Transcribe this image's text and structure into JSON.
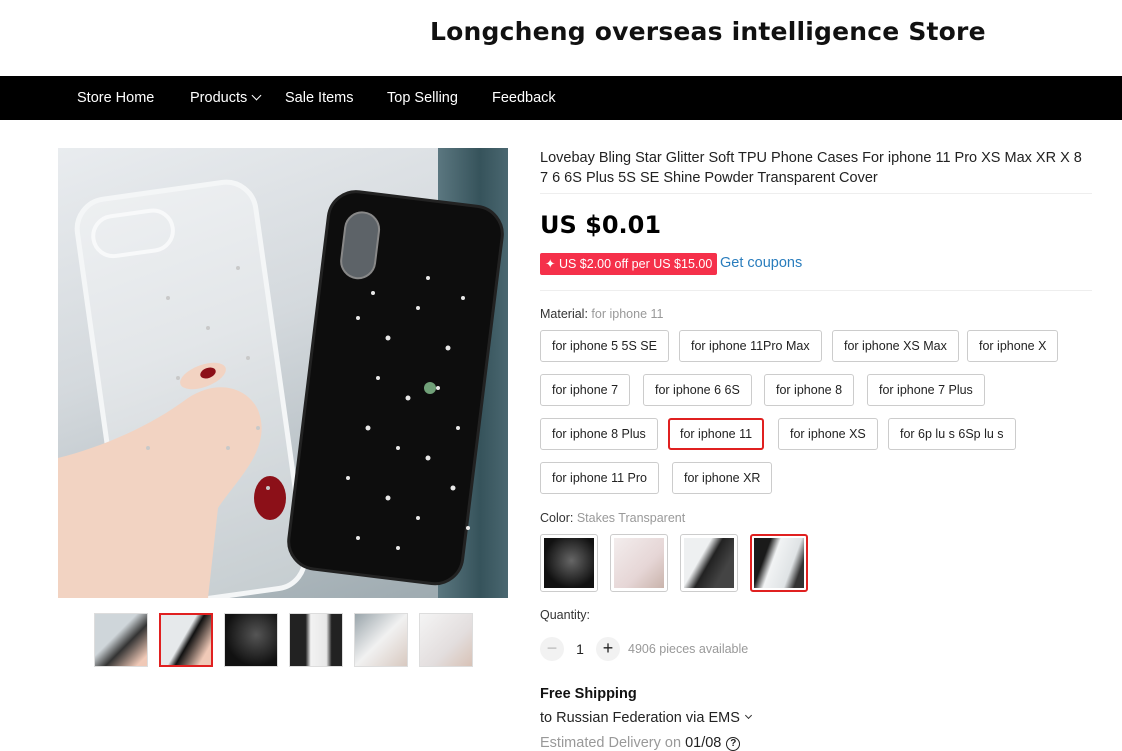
{
  "store": {
    "title": "Longcheng overseas intelligence Store"
  },
  "nav": {
    "items": [
      {
        "label": "Store Home"
      },
      {
        "label": "Products"
      },
      {
        "label": "Sale Items"
      },
      {
        "label": "Top Selling"
      },
      {
        "label": "Feedback"
      }
    ]
  },
  "product": {
    "title": "Lovebay Bling Star Glitter Soft TPU Phone Cases For iphone 11 Pro XS Max XR X 8 7 6 6S Plus 5S SE Shine Powder Transparent Cover",
    "price": "US $0.01",
    "coupon_badge": "✦ US $2.00 off per US $15.00",
    "get_coupons": "Get coupons"
  },
  "material": {
    "label": "Material:",
    "selected": "for iphone 11",
    "options": [
      "for iphone 5 5S SE",
      "for iphone 11Pro Max",
      "for iphone XS Max",
      "for iphone X",
      "for iphone 7",
      "for iphone 6 6S",
      "for iphone 8",
      "for iphone 7 Plus",
      "for iphone 8 Plus",
      "for iphone 11",
      "for iphone XS",
      "for 6p lu s 6Sp lu s",
      "for iphone 11 Pro",
      "for iphone XR"
    ]
  },
  "color": {
    "label": "Color:",
    "selected": "Stakes Transparent"
  },
  "quantity": {
    "label": "Quantity:",
    "minus": "−",
    "plus": "+",
    "value": "1",
    "available": "4906 pieces available"
  },
  "shipping": {
    "title": "Free Shipping",
    "destination": "to Russian Federation via EMS",
    "estimated_label": "Estimated Delivery on",
    "estimated_date": "01/08",
    "help": "?"
  },
  "gallery": {
    "active_thumb": 2,
    "thumb_count": 6
  },
  "colors": {
    "accent": "#e02020",
    "coupon": "#f5304a",
    "link": "#2a7dbd",
    "nav_bg": "#000000"
  }
}
